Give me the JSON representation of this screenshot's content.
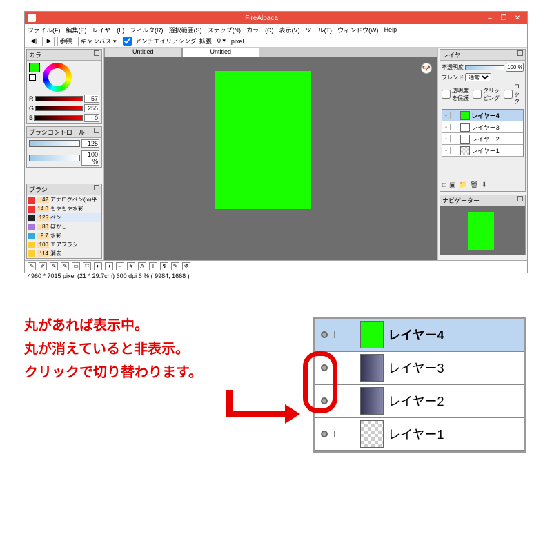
{
  "window": {
    "title": "FireAlpaca",
    "min": "–",
    "max": "❐",
    "close": "✕"
  },
  "menu": [
    "ファイル(F)",
    "編集(E)",
    "レイヤー(L)",
    "フィルタ(R)",
    "選択範囲(S)",
    "スナップ(N)",
    "カラー(C)",
    "表示(V)",
    "ツール(T)",
    "ウィンドウ(W)",
    "Help"
  ],
  "toolbar": {
    "back": "◀|",
    "fwd": "|▶",
    "ref": "参照",
    "canvas": "キャンバス ▾",
    "aa": "アンチエイリアシング",
    "ext": "拡張",
    "extval": "0 ▾",
    "unit": "pixel"
  },
  "panels": {
    "color": {
      "title": "カラー",
      "rgb": [
        {
          "label": "R",
          "value": "57"
        },
        {
          "label": "G",
          "value": "255"
        },
        {
          "label": "B",
          "value": "0"
        }
      ]
    },
    "brushctrl": {
      "title": "ブラシコントロール",
      "rows": [
        {
          "value": "125"
        },
        {
          "value": "100 %"
        }
      ]
    },
    "brush": {
      "title": "ブラシ",
      "items": [
        {
          "color": "#e33",
          "size": "42",
          "name": "アナログペン(ω)平"
        },
        {
          "color": "#e33",
          "size": "14.0",
          "name": "もやもや水彩"
        },
        {
          "color": "#222",
          "size": "125",
          "name": "ペン",
          "sel": true
        },
        {
          "color": "#a7d",
          "size": "80",
          "name": "ぼかし"
        },
        {
          "color": "#3ad",
          "size": "9.7",
          "name": "水彩"
        },
        {
          "color": "#fc3",
          "size": "100",
          "name": "エアブラシ"
        },
        {
          "color": "#fc3",
          "size": "114",
          "name": "消去"
        }
      ]
    },
    "layer": {
      "title": "レイヤー",
      "opacity_label": "不透明度",
      "opacity_value": "100 %",
      "blend_label": "ブレンド",
      "blend_value": "通常",
      "chk_protect": "透明度を保護",
      "chk_clip": "クリッピング",
      "chk_lock": "ロック",
      "rows": [
        {
          "name": "レイヤー4",
          "thumb": "green",
          "sel": true
        },
        {
          "name": "レイヤー3",
          "thumb": "ppl"
        },
        {
          "name": "レイヤー2",
          "thumb": "ppl"
        },
        {
          "name": "レイヤー1",
          "thumb": "check"
        }
      ],
      "ops": [
        "□",
        "▣",
        "📁",
        "🗑",
        "⬇"
      ]
    },
    "navigator": {
      "title": "ナビゲーター"
    }
  },
  "tabs": [
    {
      "label": "Untitled",
      "active": false
    },
    {
      "label": "Untitled",
      "active": true
    }
  ],
  "tools": [
    "✎",
    "✐",
    "✎",
    "✎",
    "▭",
    "⬚",
    "◐",
    "◑",
    "⇔",
    "#",
    "A",
    "T",
    "↯",
    "✎",
    "↺"
  ],
  "status": "4960 * 7015 pixel  (21 * 29.7cm)   600 dpi   6 %   ( 9984, 1668 )",
  "annotation": {
    "line1": "丸があれば表示中。",
    "line2": "丸が消えていると非表示。",
    "line3": "クリックで切り替わります。",
    "rows": [
      {
        "name": "レイヤー4",
        "thumb": "green",
        "sel": true
      },
      {
        "name": "レイヤー3",
        "thumb": "ppl"
      },
      {
        "name": "レイヤー2",
        "thumb": "ppl"
      },
      {
        "name": "レイヤー1",
        "thumb": "check"
      }
    ]
  }
}
